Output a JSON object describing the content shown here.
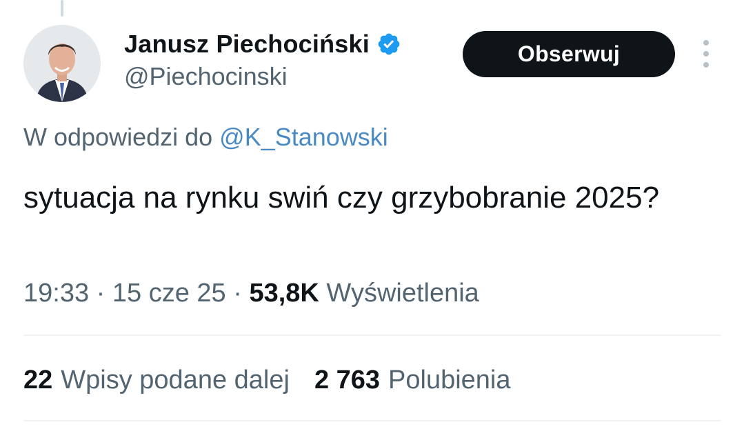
{
  "author": {
    "display_name": "Janusz Piechociński",
    "handle": "@Piechocinski",
    "verified": true
  },
  "follow_button": {
    "label": "Obserwuj"
  },
  "reply": {
    "prefix": "W odpowiedzi do ",
    "mention": "@K_Stanowski"
  },
  "tweet": {
    "text": "sytuacja na rynku swiń czy grzybobranie 2025?"
  },
  "meta": {
    "time": "19:33",
    "separator": " · ",
    "date": "15 cze 25",
    "views_count": "53,8K",
    "views_label": " Wyświetlenia"
  },
  "stats": {
    "reposts_count": "22",
    "reposts_label": "Wpisy podane dalej",
    "likes_count": "2 763",
    "likes_label": "Polubienia"
  },
  "colors": {
    "verified": "#1d9bf0",
    "link": "#4a8ac4",
    "secondary_text": "#536471",
    "primary_text": "#0f1419"
  }
}
